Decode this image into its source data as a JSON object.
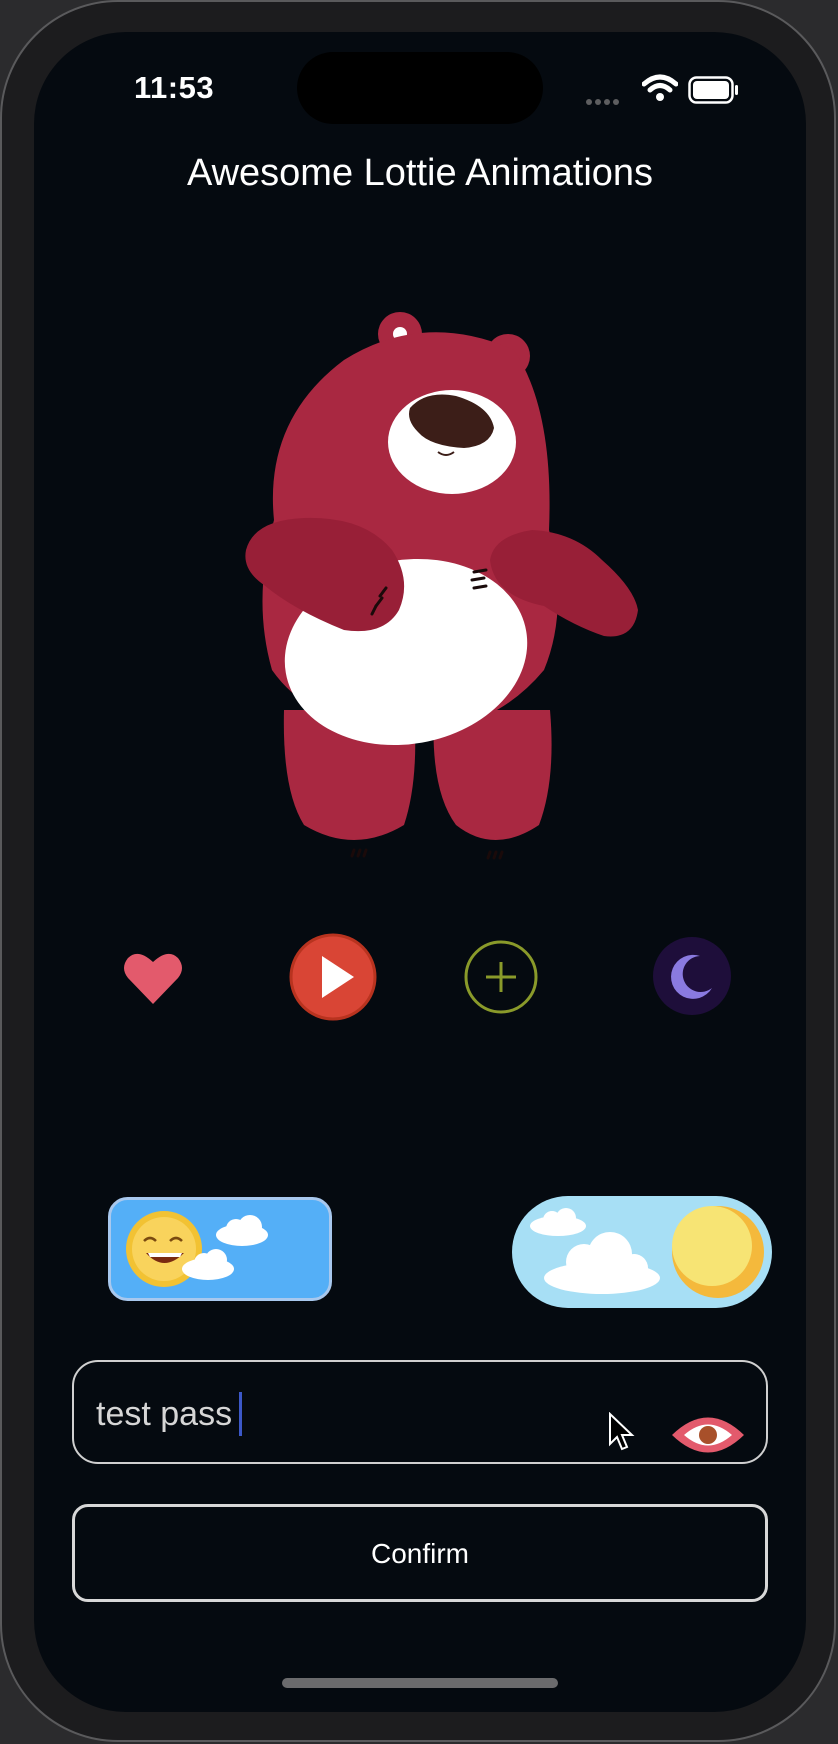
{
  "status_bar": {
    "time": "11:53"
  },
  "app": {
    "title": "Awesome Lottie Animations"
  },
  "password": {
    "value": "test pass"
  },
  "confirm": {
    "label": "Confirm"
  },
  "icons": {
    "favorite": "heart-icon",
    "play": "play-icon",
    "add": "plus-icon",
    "theme": "moon-icon",
    "visibility": "eye-icon"
  },
  "colors": {
    "background": "#050a10",
    "heart": "#e35a6c",
    "play": "#d94535",
    "add": "#8a9a2a",
    "moon_bg": "#1e0e3a",
    "moon": "#8a7ae0",
    "toggle_day": "#54aff7",
    "toggle_sky": "#a7dff5"
  }
}
